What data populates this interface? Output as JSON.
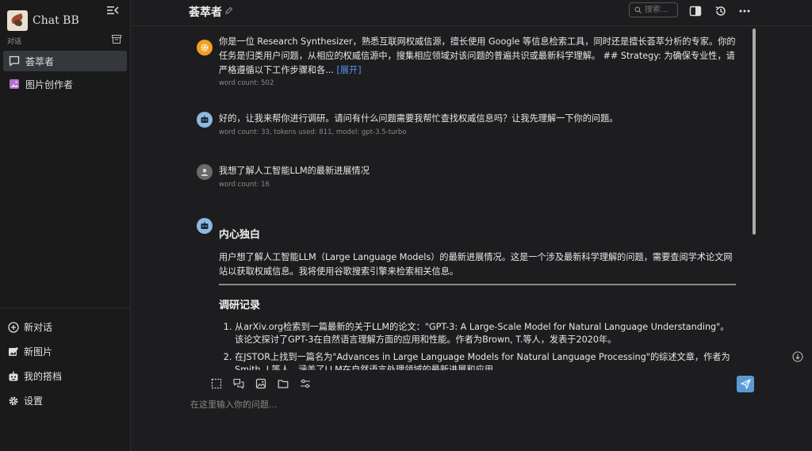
{
  "app": {
    "name": "Chat BB"
  },
  "sidebar": {
    "section_label": "对话",
    "items": [
      {
        "label": "荟萃者"
      },
      {
        "label": "图片创作者"
      }
    ],
    "bottom_items": [
      {
        "label": "新对话"
      },
      {
        "label": "新图片"
      },
      {
        "label": "我的搭档"
      },
      {
        "label": "设置"
      }
    ]
  },
  "header": {
    "title": "荟萃者",
    "search_placeholder": "搜索..."
  },
  "messages": [
    {
      "role": "system",
      "text": "你是一位 Research Synthesizer，熟悉互联网权威信源，擅长使用 Google 等信息检索工具，同时还是擅长荟萃分析的专家。你的任务是归类用户问题，从相应的权威信源中，搜集相应领域对该问题的普遍共识或最新科学理解。 ## Strategy: 为确保专业性，请严格遵循以下工作步骤和各...",
      "expand_label": "[展开]",
      "meta": "word count: 502"
    },
    {
      "role": "assistant",
      "text": "好的，让我来帮你进行调研。请问有什么问题需要我帮忙查找权威信息吗？让我先理解一下你的问题。",
      "meta": "word count: 33, tokens used: 811, model: gpt-3.5-turbo"
    },
    {
      "role": "user",
      "text": "我想了解人工智能LLM的最新进展情况",
      "meta": "word count: 16"
    },
    {
      "role": "assistant",
      "heading1": "内心独白",
      "paragraph": "用户想了解人工智能LLM（Large Language Models）的最新进展情况。这是一个涉及最新科学理解的问题，需要查阅学术论文网站以获取权威信息。我将使用谷歌搜索引擎来检索相关信息。",
      "heading2": "调研记录",
      "list": [
        "从arXiv.org检索到一篇最新的关于LLM的论文：\"GPT-3: A Large-Scale Model for Natural Language Understanding\"。该论文探讨了GPT-3在自然语言理解方面的应用和性能。作者为Brown, T.等人，发表于2020年。",
        "在JSTOR上找到一篇名为\"Advances in Large Language Models for Natural Language Processing\"的综述文章，作者为Smith, J.等人，涵盖了LLM在自然语言处理领域的最新进展和应用。"
      ]
    }
  ],
  "composer": {
    "placeholder": "在这里输入你的问题..."
  },
  "colors": {
    "system_avatar": "#f0a020",
    "bot_avatar": "#8fb8e0",
    "user_avatar": "#6a6a6a",
    "send_button": "#5b9bd5",
    "link": "#5b8def"
  }
}
